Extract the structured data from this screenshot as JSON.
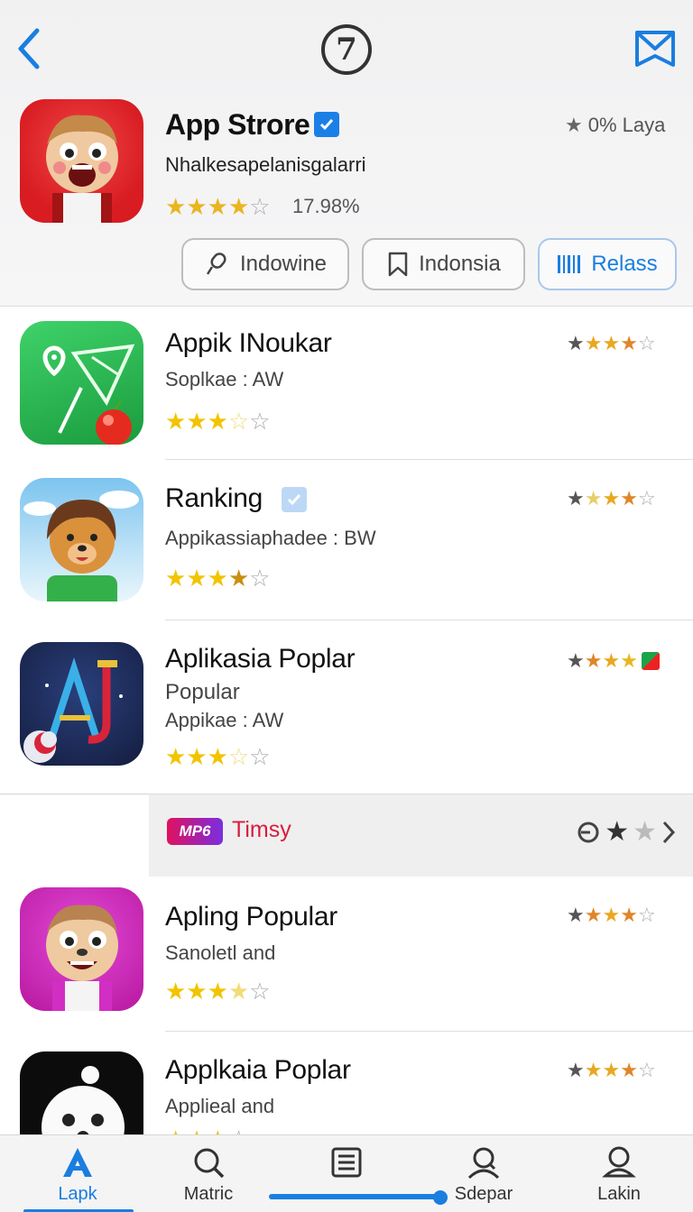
{
  "header": {
    "logo_glyph": "7",
    "title": "App Strore",
    "subtitle": "Nhalkesapelanisgalarri",
    "meta_label": "0% Laya",
    "percent": "17.98%",
    "rating": 4,
    "chips": [
      {
        "label": "Indowine",
        "icon": "microphone-icon"
      },
      {
        "label": "Indonsia",
        "icon": "bookmark-icon"
      },
      {
        "label": "Relass",
        "icon": "barcode-icon"
      }
    ]
  },
  "apps": [
    {
      "title": "Appik INoukar",
      "subtitle": "Soplkae : AW",
      "stars": 3,
      "rating": 3.5
    },
    {
      "title": "Ranking",
      "subtitle": "Appikassiaphadee : BW",
      "stars": 3.5,
      "rating": 3.5
    },
    {
      "title": "Aplikasia Poplar",
      "subtitle": "Popular",
      "subtitle2": "Appikae : AW",
      "stars": 3,
      "rating": 3.5
    },
    {
      "title": "Apling Popular",
      "subtitle": "Sanoletl and",
      "stars": 3.5,
      "rating": 3.5
    },
    {
      "title": "Applkaia Poplar",
      "subtitle": "Applieal and",
      "stars": 3.5,
      "rating": 3.5
    }
  ],
  "ad": {
    "badge": "MP6",
    "label": "Timsy"
  },
  "tabs": [
    {
      "label": "Lapk",
      "icon": "apps-icon",
      "active": true
    },
    {
      "label": "Matric",
      "icon": "search-icon"
    },
    {
      "label": "",
      "icon": "list-icon"
    },
    {
      "label": "Sdepar",
      "icon": "person-search-icon"
    },
    {
      "label": "Lakin",
      "icon": "profile-icon"
    }
  ],
  "colors": {
    "accent": "#1a7ee0",
    "star": "#f2c400",
    "ad": "#d81d3e"
  }
}
